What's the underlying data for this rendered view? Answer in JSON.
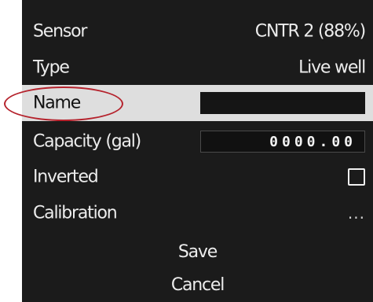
{
  "rows": [
    {
      "label": "Sensor",
      "value": "CNTR 2 (88%)"
    },
    {
      "label": "Type",
      "value": "Live well"
    },
    {
      "label": "Name",
      "value": ""
    },
    {
      "label": "Capacity (gal)",
      "value": "0000.00"
    },
    {
      "label": "Inverted",
      "checked": false
    },
    {
      "label": "Calibration",
      "value": "..."
    }
  ],
  "actions": {
    "save": "Save",
    "cancel": "Cancel"
  },
  "colors": {
    "panel_bg": "#1b1b1b",
    "selected_row_bg": "#dedede",
    "highlight_ring": "#b5222c"
  }
}
